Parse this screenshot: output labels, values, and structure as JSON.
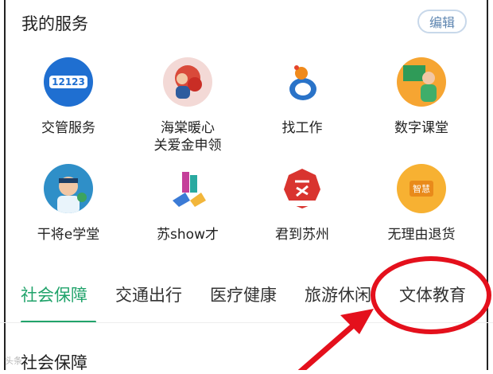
{
  "header": {
    "title": "我的服务",
    "edit_label": "编辑"
  },
  "services": [
    {
      "label": "交管服务",
      "icon": "jiaoguan-12123-icon",
      "icon_text": "12123"
    },
    {
      "label": "海棠暖心\n关爱金申领",
      "icon": "haitang-care-icon"
    },
    {
      "label": "找工作",
      "icon": "find-job-icon"
    },
    {
      "label": "数字课堂",
      "icon": "digital-classroom-icon"
    },
    {
      "label": "干将e学堂",
      "icon": "ganjiang-school-icon"
    },
    {
      "label": "苏show才",
      "icon": "sushow-icon"
    },
    {
      "label": "君到苏州",
      "icon": "jundao-suzhou-icon"
    },
    {
      "label": "无理由退货",
      "icon": "refund-icon",
      "icon_text": "智慧"
    }
  ],
  "tabs": [
    {
      "label": "社会保障",
      "active": true
    },
    {
      "label": "交通出行",
      "active": false
    },
    {
      "label": "医疗健康",
      "active": false
    },
    {
      "label": "旅游休闲",
      "active": false
    },
    {
      "label": "文体教育",
      "active": false
    }
  ],
  "section": {
    "title": "社会保障"
  },
  "watermark": "头条",
  "colors": {
    "accent": "#21a36b",
    "annotation": "#e4101c",
    "edit_border": "#c8d8ea"
  }
}
